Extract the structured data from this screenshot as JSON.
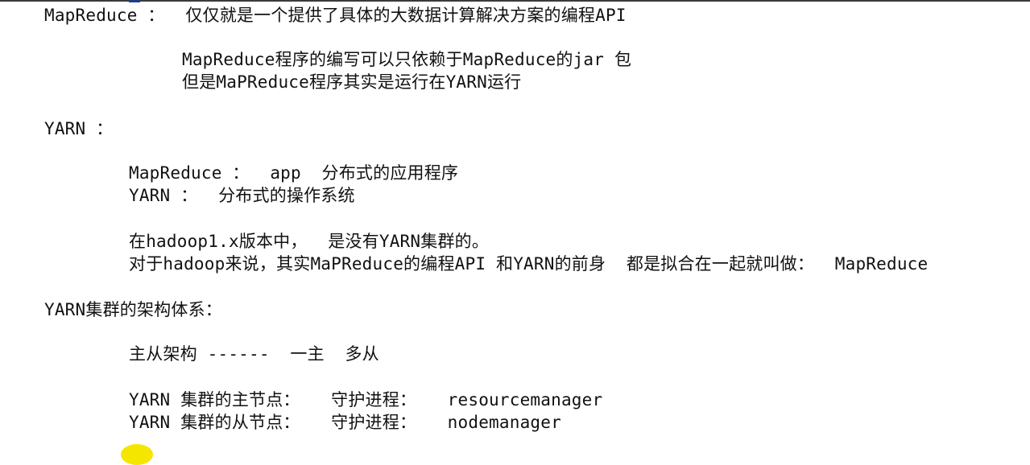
{
  "document": {
    "lines": [
      "MapReduce ：  仅仅就是一个提供了具体的大数据计算解决方案的编程API",
      "MapReduce程序的编写可以只依赖于MapReduce的jar 包",
      "但是MaPReduce程序其实是运行在YARN运行",
      "YARN ：",
      "MapReduce ：  app  分布式的应用程序",
      "YARN ：  分布式的操作系统",
      "在hadoop1.x版本中，  是没有YARN集群的。",
      "对于hadoop来说，其实MaPReduce的编程API 和YARN的前身  都是拟合在一起就叫做：  MapReduce",
      "YARN集群的架构体系：",
      "主从架构 ------  一主  多从",
      "YARN 集群的主节点：   守护进程：   resourcemanager",
      "YARN 集群的从节点：   守护进程：   nodemanager"
    ]
  },
  "colors": {
    "text": "#111111",
    "top_line": "#3a3a3a",
    "caret": "#1f3c88",
    "cursor_highlight": "#f5e600"
  }
}
